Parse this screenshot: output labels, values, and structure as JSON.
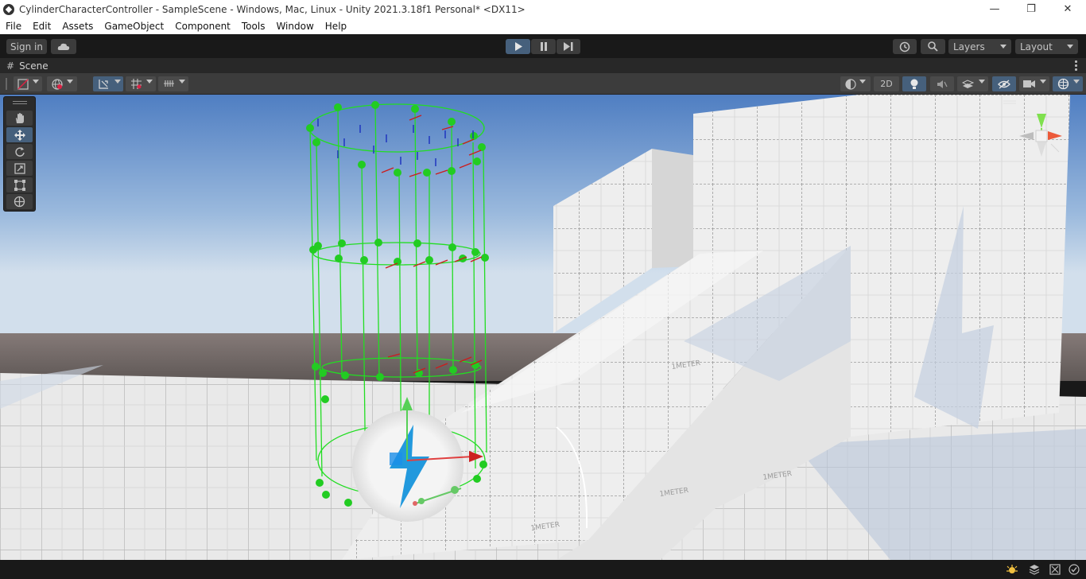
{
  "window": {
    "title": "CylinderCharacterController - SampleScene - Windows, Mac, Linux - Unity 2021.3.18f1 Personal* <DX11>",
    "minimize_glyph": "—",
    "maximize_glyph": "❐",
    "close_glyph": "✕"
  },
  "menu": {
    "items": [
      "File",
      "Edit",
      "Assets",
      "GameObject",
      "Component",
      "Tools",
      "Window",
      "Help"
    ]
  },
  "toolbar": {
    "sign_in_label": "Sign in",
    "layers_label": "Layers",
    "layout_label": "Layout",
    "icons": [
      "cloud-icon",
      "play-icon",
      "pause-icon",
      "step-icon",
      "history-icon",
      "search-icon"
    ],
    "accent": "#46607c"
  },
  "scene_tab": {
    "hash": "#",
    "label": "Scene"
  },
  "scene_toolbar": {
    "two_d_label": "2D",
    "icons": [
      "draw-mode-icon",
      "globe-icon",
      "move-snap-icon",
      "grid-snap-icon",
      "increment-snap-icon",
      "shading-icon",
      "lighting-icon",
      "audio-icon",
      "effects-icon",
      "visibility-icon",
      "camera-icon",
      "gizmos-icon"
    ]
  },
  "tools": {
    "items": [
      "hand-tool-icon",
      "move-tool-icon",
      "rotate-tool-icon",
      "scale-tool-icon",
      "rect-tool-icon",
      "transform-tool-icon"
    ],
    "active": "move-tool-icon"
  },
  "viewport": {
    "sky_top": "#4d7cc0",
    "sky_horizon": "#c9d9e9",
    "ground_far": "#7a6d69",
    "floor_color": "#e6e6e6",
    "wireframe_color": "#22dd22",
    "floor_text": "1METER",
    "lightning_color": "#2299dd"
  },
  "statusbar": {
    "icons": [
      "bug-icon",
      "stack-icon",
      "bake-icon",
      "check-icon"
    ]
  }
}
